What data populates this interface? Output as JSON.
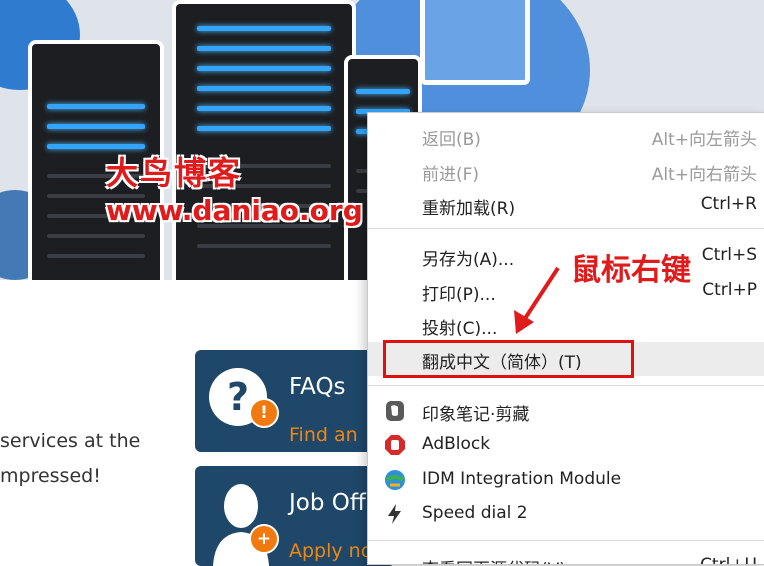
{
  "hero": {
    "site_name": "大鸟博客",
    "site_url": "www.daniao.org"
  },
  "page": {
    "line1": "services at the",
    "line2": "mpressed!"
  },
  "cards": [
    {
      "title": "FAQs",
      "subtitle": "Find an",
      "icon": "question-icon",
      "badge": "!"
    },
    {
      "title": "Job Off",
      "subtitle": "Apply no",
      "icon": "person-icon",
      "badge": "+"
    }
  ],
  "context_menu": {
    "items": [
      {
        "label": "返回(B)",
        "shortcut": "Alt+向左箭头",
        "disabled": true
      },
      {
        "label": "前进(F)",
        "shortcut": "Alt+向右箭头",
        "disabled": true
      },
      {
        "label": "重新加载(R)",
        "shortcut": "Ctrl+R",
        "disabled": false
      },
      {
        "label": "另存为(A)...",
        "shortcut": "Ctrl+S",
        "disabled": false
      },
      {
        "label": "打印(P)...",
        "shortcut": "Ctrl+P",
        "disabled": false
      },
      {
        "label": "投射(C)...",
        "shortcut": "",
        "disabled": false
      },
      {
        "label": "翻成中文（简体）(T)",
        "shortcut": "",
        "disabled": false,
        "highlighted": true
      },
      {
        "label": "印象笔记·剪藏",
        "icon": "evernote-icon"
      },
      {
        "label": "AdBlock",
        "icon": "adblock-icon"
      },
      {
        "label": "IDM Integration Module",
        "icon": "idm-icon"
      },
      {
        "label": "Speed dial 2",
        "icon": "lightning-icon"
      },
      {
        "label": "查看网页源代码(V)",
        "shortcut": "Ctrl+U",
        "disabled": false
      }
    ]
  },
  "annotation": {
    "text": "鼠标右键",
    "color": "#e01b1b"
  },
  "colors": {
    "brand_red": "#e01b1b",
    "card_bg": "#1f4769",
    "card_accent": "#f0870f",
    "server_light": "#31a5ff"
  }
}
